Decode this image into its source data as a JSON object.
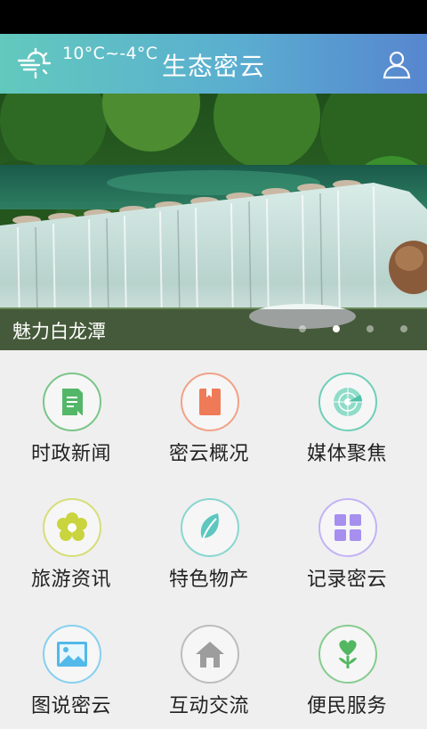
{
  "header": {
    "temperature": "10°C~-4°C",
    "title": "生态密云",
    "weather_icon": "sun-wind-icon",
    "user_icon": "user-icon"
  },
  "banner": {
    "caption": "魅力白龙潭",
    "slide_count": 4,
    "active_slide": 2
  },
  "menu": [
    {
      "label": "时政新闻",
      "icon": "document-icon",
      "color": "#54b768"
    },
    {
      "label": "密云概况",
      "icon": "book-icon",
      "color": "#ef7a57"
    },
    {
      "label": "媒体聚焦",
      "icon": "radar-icon",
      "color": "#4fc2a9"
    },
    {
      "label": "旅游资讯",
      "icon": "flower-icon",
      "color": "#c9d43e"
    },
    {
      "label": "特色物产",
      "icon": "leaf-icon",
      "color": "#5dc7c0"
    },
    {
      "label": "记录密云",
      "icon": "grid-icon",
      "color": "#a78ff0"
    },
    {
      "label": "图说密云",
      "icon": "picture-icon",
      "color": "#52b9ea"
    },
    {
      "label": "互动交流",
      "icon": "home-icon",
      "color": "#9d9d9d"
    },
    {
      "label": "便民服务",
      "icon": "plant-heart-icon",
      "color": "#52b760"
    }
  ]
}
